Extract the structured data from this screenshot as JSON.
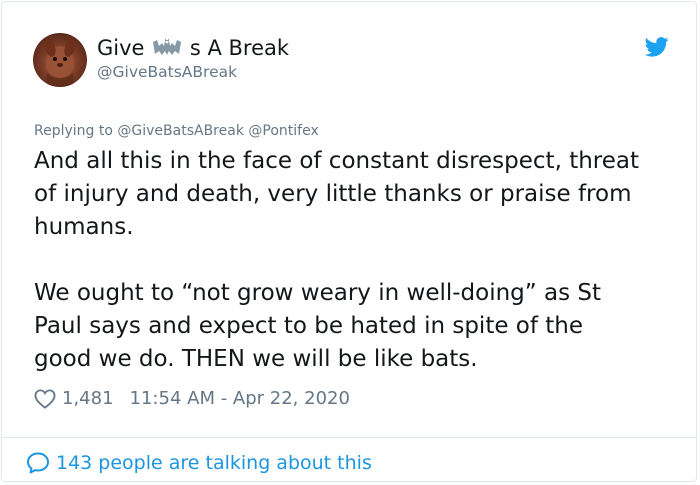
{
  "author": {
    "name_before_icon": "Give",
    "name_icon": "bat-icon",
    "name_after_icon": "s A Break",
    "handle": "@GiveBatsABreak"
  },
  "reply": {
    "prefix": "Replying to",
    "mention_1": "@GiveBatsABreak",
    "mention_2": "@Pontifex"
  },
  "tweet": {
    "paragraph_1": "And all this in the face of constant disrespect, threat\nof injury and death, very little thanks or praise from\nhumans.",
    "paragraph_2": "We ought to “not grow weary in well-doing” as St\nPaul says and expect to be hated in spite of the\ngood we do. THEN we will be like bats."
  },
  "meta": {
    "like_icon": "heart-icon",
    "likes": "1,481",
    "timestamp": "11:54 AM - Apr 22, 2020"
  },
  "footer": {
    "icon": "speech-bubble-icon",
    "talking_text": "143 people are talking about this"
  },
  "colors": {
    "text": "#14171a",
    "secondary": "#657786",
    "accent": "#1b95e0",
    "border": "#e1e8ed"
  }
}
